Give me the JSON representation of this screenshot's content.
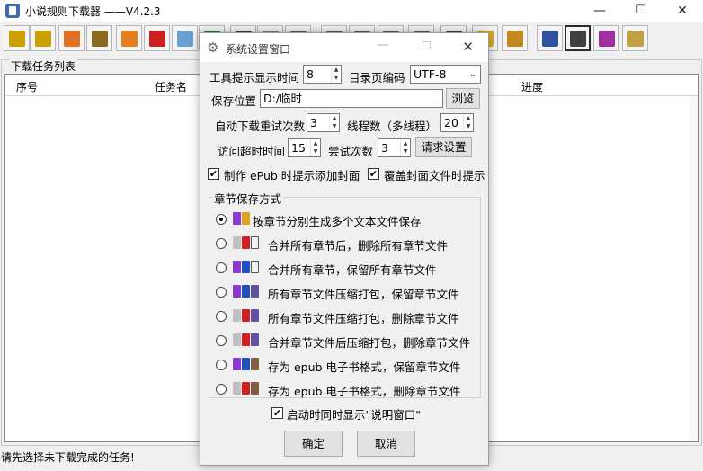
{
  "window": {
    "title": "小说规则下载器 ——V4.2.3",
    "minimize": "—",
    "maximize": "☐",
    "close": "✕"
  },
  "toolbar": {
    "buttons": [
      {
        "icon": "download-cpu-icon",
        "color": "#c8a000"
      },
      {
        "icon": "book-download-icon",
        "color": "#c8a000"
      },
      {
        "icon": "refresh-icon",
        "color": "#e07020"
      },
      {
        "icon": "notebook-icon",
        "color": "#8a6a20"
      },
      {
        "icon": "edit-icon",
        "color": "#e08020"
      },
      {
        "icon": "import-icon",
        "color": "#c82020"
      },
      {
        "icon": "file-icon",
        "color": "#6aa0d0"
      },
      {
        "icon": "green-file-icon",
        "color": "#208040"
      },
      {
        "icon": "play-icon",
        "color": "#404040"
      },
      {
        "icon": "bookmark-icon",
        "color": "#808080"
      },
      {
        "icon": "up-icon",
        "color": "#606060"
      },
      {
        "icon": "user-icon",
        "color": "#606060"
      },
      {
        "icon": "user-add-icon",
        "color": "#606060"
      },
      {
        "icon": "note-icon",
        "color": "#606060"
      },
      {
        "icon": "clip-icon",
        "color": "#606060"
      },
      {
        "icon": "sync-icon",
        "color": "#404040"
      },
      {
        "icon": "folder-open-icon",
        "color": "#d8b020"
      },
      {
        "icon": "epub-icon",
        "color": "#c08a20"
      },
      {
        "icon": "list-icon",
        "color": "#3050a0"
      },
      {
        "icon": "gear-icon",
        "color": "#404040"
      },
      {
        "icon": "help-book-icon",
        "color": "#a030a0"
      },
      {
        "icon": "eye-icon",
        "color": "#c0a040"
      }
    ]
  },
  "task_list": {
    "legend": "下载任务列表",
    "columns": [
      "序号",
      "任务名",
      "进度"
    ]
  },
  "status": "请先选择未下载完成的任务!",
  "dialog": {
    "title": "系统设置窗口",
    "tooltip_time_label": "工具提示显示时间",
    "tooltip_time_value": "8",
    "encoding_label": "目录页编码",
    "encoding_value": "UTF-8",
    "save_path_label": "保存位置",
    "save_path_value": "D:/临时",
    "browse_label": "浏览",
    "retry_label": "自动下载重试次数",
    "retry_value": "3",
    "threads_label": "线程数（多线程）",
    "threads_value": "20",
    "timeout_label": "访问超时时间",
    "timeout_value": "15",
    "attempts_label": "尝试次数",
    "attempts_value": "3",
    "request_settings_label": "请求设置",
    "epub_cover_prompt_label": "制作 ePub 时提示添加封面",
    "epub_cover_prompt_checked": true,
    "overwrite_cover_prompt_label": "覆盖封面文件时提示",
    "overwrite_cover_prompt_checked": true,
    "save_mode_legend": "章节保存方式",
    "save_modes": [
      {
        "label": "按章节分别生成多个文本文件保存",
        "selected": true
      },
      {
        "label": "合并所有章节后，删除所有章节文件",
        "selected": false
      },
      {
        "label": "合并所有章节，保留所有章节文件",
        "selected": false
      },
      {
        "label": "所有章节文件压缩打包，保留章节文件",
        "selected": false
      },
      {
        "label": "所有章节文件压缩打包，删除章节文件",
        "selected": false
      },
      {
        "label": "合并章节文件后压缩打包，删除章节文件",
        "selected": false
      },
      {
        "label": "存为 epub 电子书格式，保留章节文件",
        "selected": false
      },
      {
        "label": "存为 epub 电子书格式，删除章节文件",
        "selected": false
      }
    ],
    "startup_prompt_label": "启动时同时显示\"说明窗口\"",
    "startup_prompt_checked": true,
    "ok_label": "确定",
    "cancel_label": "取消"
  }
}
